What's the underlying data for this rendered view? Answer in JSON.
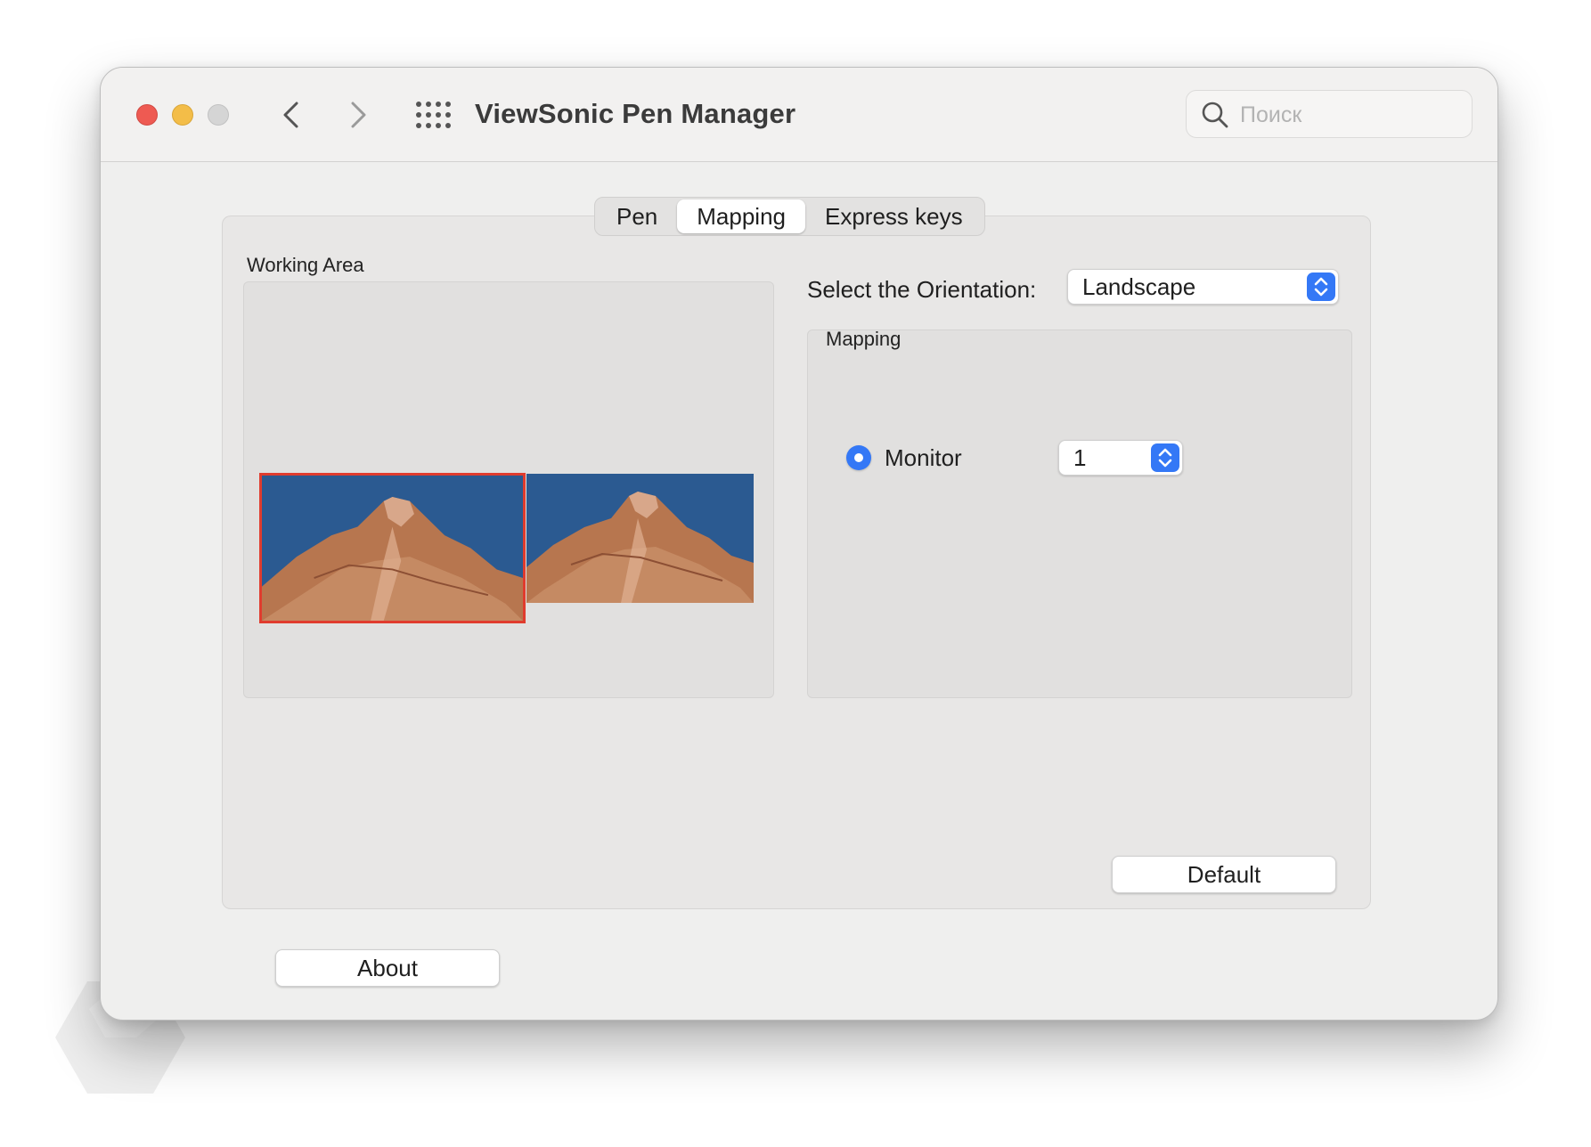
{
  "window": {
    "title": "ViewSonic Pen Manager",
    "search_placeholder": "Поиск"
  },
  "tabs": [
    {
      "label": "Pen",
      "active": false
    },
    {
      "label": "Mapping",
      "active": true
    },
    {
      "label": "Express keys",
      "active": false
    }
  ],
  "working_area": {
    "label": "Working Area",
    "monitors": [
      {
        "index": 1,
        "selected": true
      },
      {
        "index": 2,
        "selected": false
      }
    ]
  },
  "orientation": {
    "label": "Select the Orientation:",
    "value": "Landscape"
  },
  "mapping": {
    "title": "Mapping",
    "radio_label": "Monitor",
    "radio_checked": true,
    "monitor_value": "1"
  },
  "buttons": {
    "default_label": "Default",
    "about_label": "About"
  },
  "colors": {
    "accent": "#3478f6",
    "selected_monitor_border": "#e03c2e",
    "close": "#ee5a52",
    "minimize": "#f3bd48",
    "maximize": "#d5d5d5"
  },
  "icons": [
    "close-button",
    "minimize-button",
    "maximize-button",
    "chevron-left-icon",
    "chevron-right-icon",
    "grid-icon",
    "search-icon",
    "stepper-icon"
  ]
}
